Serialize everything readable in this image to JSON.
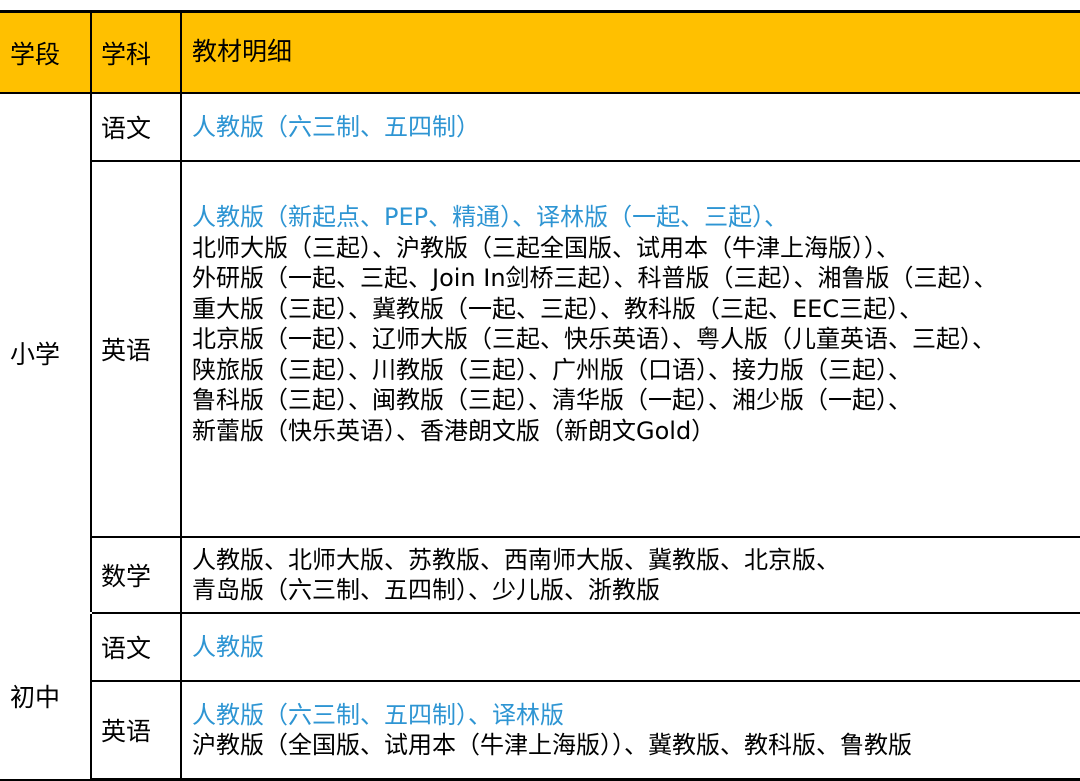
{
  "header": {
    "stage": "学段",
    "subject": "学科",
    "details": "教材明细"
  },
  "sections": [
    {
      "stage": "小学",
      "rows": [
        {
          "subject": "语文",
          "lines": [
            {
              "text": "人教版（六三制、五四制）",
              "color": "blue"
            }
          ]
        },
        {
          "subject": "英语",
          "lines": [
            {
              "text": "人教版（新起点、PEP、精通）、译林版（一起、三起）、",
              "color": "blue"
            },
            {
              "text": "北师大版（三起）、沪教版（三起全国版、试用本（牛津上海版））、",
              "color": "black"
            },
            {
              "text": "外研版（一起、三起、Join In剑桥三起）、科普版（三起）、湘鲁版（三起）、",
              "color": "black"
            },
            {
              "text": "重大版（三起）、冀教版（一起、三起）、教科版（三起、EEC三起）、",
              "color": "black"
            },
            {
              "text": "北京版（一起）、辽师大版（三起、快乐英语）、粤人版（儿童英语、三起）、",
              "color": "black"
            },
            {
              "text": "陕旅版（三起）、川教版（三起）、广州版（口语）、接力版（三起）、",
              "color": "black"
            },
            {
              "text": "鲁科版（三起）、闽教版（三起）、清华版（一起）、湘少版（一起）、",
              "color": "black"
            },
            {
              "text": "新蕾版（快乐英语）、香港朗文版（新朗文Gold）",
              "color": "black"
            }
          ]
        },
        {
          "subject": "数学",
          "lines": [
            {
              "text": "人教版、北师大版、苏教版、西南师大版、冀教版、北京版、",
              "color": "black"
            },
            {
              "text": "青岛版（六三制、五四制）、少儿版、浙教版",
              "color": "black"
            }
          ]
        }
      ]
    },
    {
      "stage": "初中",
      "rows": [
        {
          "subject": "语文",
          "lines": [
            {
              "text": "人教版",
              "color": "blue"
            }
          ]
        },
        {
          "subject": "英语",
          "lines": [
            {
              "text": "人教版（六三制、五四制）、译林版",
              "color": "blue"
            },
            {
              "text": "沪教版（全国版、试用本（牛津上海版））、冀教版、教科版、鲁教版",
              "color": "black"
            }
          ]
        }
      ]
    }
  ],
  "colors": {
    "header_bg": "#ffc000",
    "highlight_text": "#2e95d3",
    "border": "#000000"
  }
}
